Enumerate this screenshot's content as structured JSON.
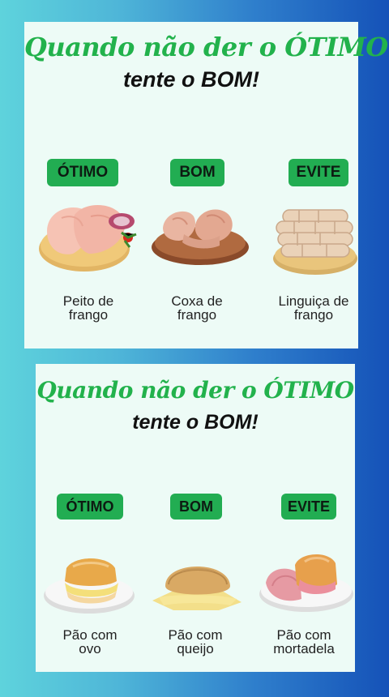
{
  "cards": [
    {
      "title": "Quando não der o ÓTIMO",
      "subtitle": "tente o BOM!",
      "items": [
        {
          "badge": "ÓTIMO",
          "label_line1": "Peito de",
          "label_line2": "frango",
          "image": "chicken-breast"
        },
        {
          "badge": "BOM",
          "label_line1": "Coxa de",
          "label_line2": "frango",
          "image": "chicken-thigh"
        },
        {
          "badge": "EVITE",
          "label_line1": "Linguiça de",
          "label_line2": "frango",
          "image": "sausage"
        }
      ]
    },
    {
      "title": "Quando não der o ÓTIMO",
      "subtitle": "tente o BOM!",
      "items": [
        {
          "badge": "ÓTIMO",
          "label_line1": "Pão com",
          "label_line2": "ovo",
          "image": "egg-sandwich"
        },
        {
          "badge": "BOM",
          "label_line1": "Pão com",
          "label_line2": "queijo",
          "image": "cheese-bread"
        },
        {
          "badge": "EVITE",
          "label_line1": "Pão com",
          "label_line2": "mortadela",
          "image": "mortadella-bread"
        }
      ]
    }
  ],
  "colors": {
    "badge": "#22ad52",
    "title": "#22b24c",
    "card": "#edfbf6"
  }
}
